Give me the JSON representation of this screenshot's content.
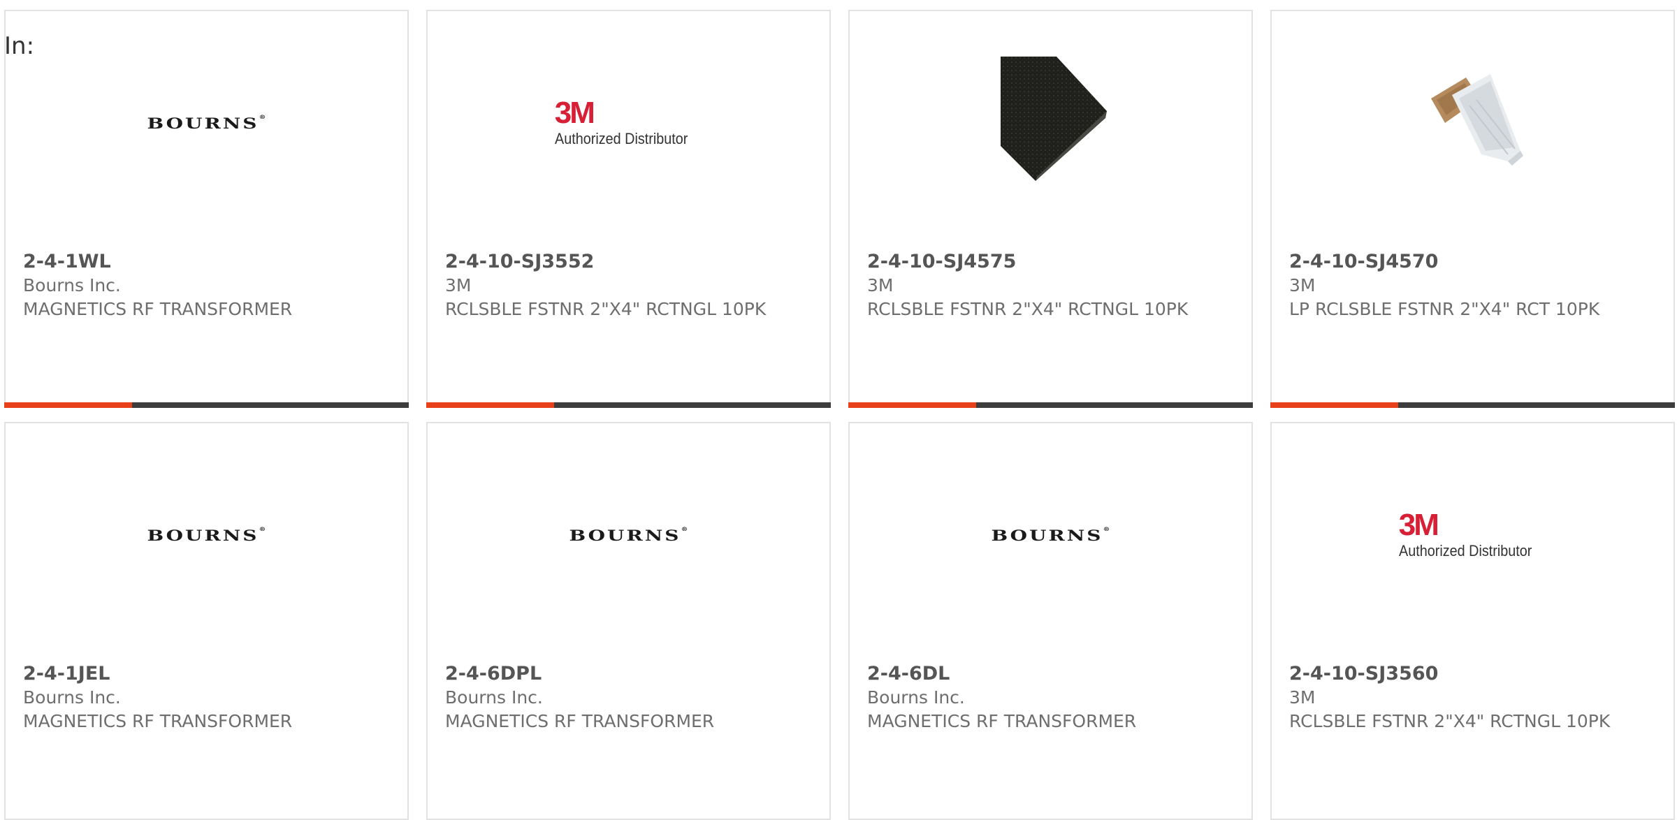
{
  "filter_label": "In:",
  "colors": {
    "accent": "#e8401a",
    "bar": "#3d3d3d",
    "card_border": "#e2e2e2",
    "logo_3m_red": "#d71f36"
  },
  "products": [
    {
      "part_number": "2-4-1WL",
      "manufacturer": "Bourns Inc.",
      "description": "MAGNETICS RF TRANSFORMER",
      "image": "bourns-logo",
      "logo_text": "BOURNS"
    },
    {
      "part_number": "2-4-10-SJ3552",
      "manufacturer": "3M",
      "description": "RCLSBLE FSTNR 2\"X4\" RCTNGL 10PK",
      "image": "3m-authorized-distributor-logo",
      "logo_text": "3M",
      "logo_subtext": "Authorized Distributor"
    },
    {
      "part_number": "2-4-10-SJ4575",
      "manufacturer": "3M",
      "description": "RCLSBLE FSTNR 2\"X4\" RCTNGL 10PK",
      "image": "black-fastener-strip-photo"
    },
    {
      "part_number": "2-4-10-SJ4570",
      "manufacturer": "3M",
      "description": "LP RCLSBLE FSTNR 2\"X4\" RCT 10PK",
      "image": "clear-fastener-strip-photo"
    },
    {
      "part_number": "2-4-1JEL",
      "manufacturer": "Bourns Inc.",
      "description": "MAGNETICS RF TRANSFORMER",
      "image": "bourns-logo",
      "logo_text": "BOURNS"
    },
    {
      "part_number": "2-4-6DPL",
      "manufacturer": "Bourns Inc.",
      "description": "MAGNETICS RF TRANSFORMER",
      "image": "bourns-logo",
      "logo_text": "BOURNS"
    },
    {
      "part_number": "2-4-6DL",
      "manufacturer": "Bourns Inc.",
      "description": "MAGNETICS RF TRANSFORMER",
      "image": "bourns-logo",
      "logo_text": "BOURNS"
    },
    {
      "part_number": "2-4-10-SJ3560",
      "manufacturer": "3M",
      "description": "RCLSBLE FSTNR 2\"X4\" RCTNGL 10PK",
      "image": "3m-authorized-distributor-logo",
      "logo_text": "3M",
      "logo_subtext": "Authorized Distributor"
    }
  ]
}
